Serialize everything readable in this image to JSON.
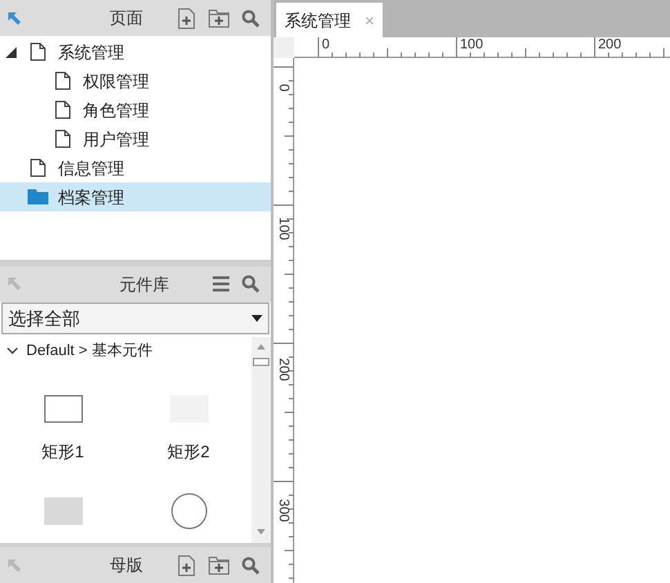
{
  "pages_panel": {
    "title": "页面",
    "tree": [
      {
        "label": "系统管理",
        "kind": "page",
        "expanded": true,
        "selected": false,
        "children": [
          {
            "label": "权限管理",
            "kind": "page",
            "selected": false
          },
          {
            "label": "角色管理",
            "kind": "page",
            "selected": false
          },
          {
            "label": "用户管理",
            "kind": "page",
            "selected": false
          }
        ]
      },
      {
        "label": "信息管理",
        "kind": "page",
        "selected": false
      },
      {
        "label": "档案管理",
        "kind": "folder",
        "selected": true
      }
    ]
  },
  "library_panel": {
    "title": "元件库",
    "select": {
      "value": "选择全部"
    },
    "group": {
      "label": "Default > 基本元件",
      "expanded": true
    },
    "widgets": [
      {
        "kind": "outline-box",
        "label": "矩形1"
      },
      {
        "kind": "light-box",
        "label": "矩形2"
      },
      {
        "kind": "gray-box"
      },
      {
        "kind": "circle"
      }
    ]
  },
  "masters_panel": {
    "title": "母版"
  },
  "tabs": [
    {
      "label": "系统管理",
      "selected": true,
      "close": "×"
    }
  ],
  "ruler": {
    "horizontal": [
      "0",
      "100",
      "200"
    ],
    "vertical": [
      "0",
      "100",
      "200",
      "300"
    ]
  }
}
